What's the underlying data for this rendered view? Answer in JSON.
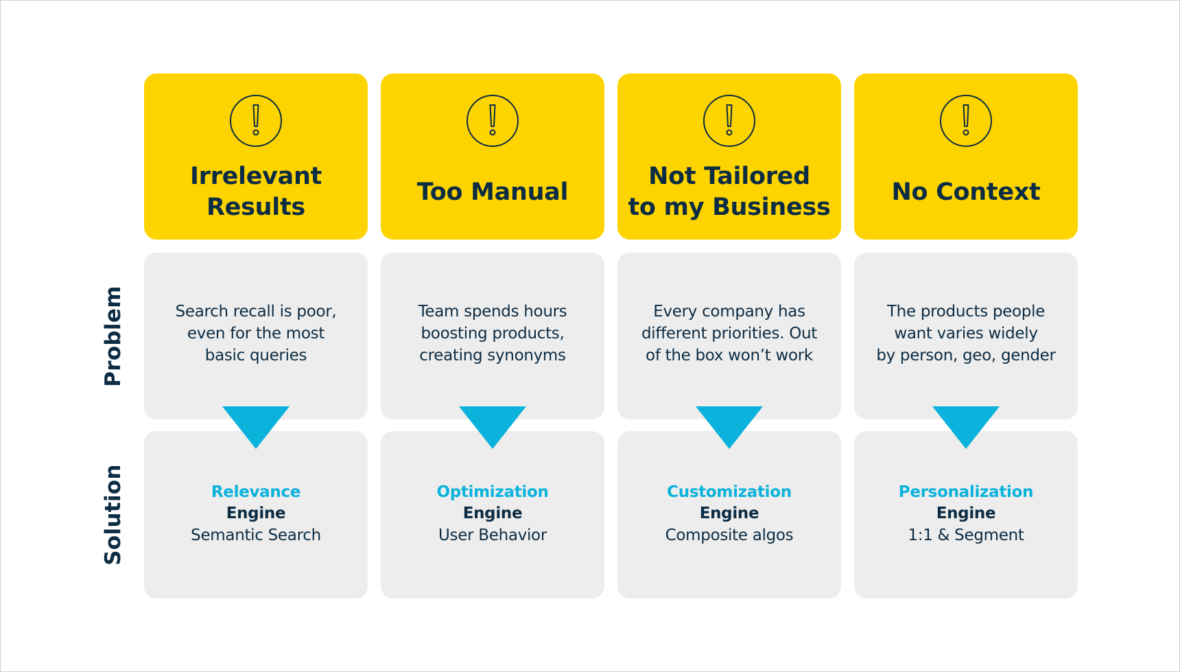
{
  "row_labels": {
    "problem": "Problem",
    "solution": "Solution"
  },
  "colors": {
    "header_bg": "#fdd400",
    "card_bg": "#ededed",
    "text_dark": "#0c2c44",
    "accent_blue": "#0ab2dc"
  },
  "columns": [
    {
      "icon": "exclamation-circle-icon",
      "title": "Irrelevant\nResults",
      "problem": "Search recall is poor,\neven for the most\nbasic queries",
      "solution_name": "Relevance",
      "solution_engine": "Engine",
      "solution_desc": "Semantic Search"
    },
    {
      "icon": "exclamation-circle-icon",
      "title": "Too Manual",
      "problem": "Team spends hours\nboosting products,\ncreating synonyms",
      "solution_name": "Optimization",
      "solution_engine": "Engine",
      "solution_desc": "User Behavior"
    },
    {
      "icon": "exclamation-circle-icon",
      "title": "Not Tailored\nto my Business",
      "problem": "Every company has\ndifferent priorities. Out\nof the box won’t work",
      "solution_name": "Customization",
      "solution_engine": "Engine",
      "solution_desc": "Composite algos"
    },
    {
      "icon": "exclamation-circle-icon",
      "title": "No Context",
      "problem": "The products people\nwant varies widely\nby person, geo, gender",
      "solution_name": "Personalization",
      "solution_engine": "Engine",
      "solution_desc": "1:1 & Segment"
    }
  ]
}
